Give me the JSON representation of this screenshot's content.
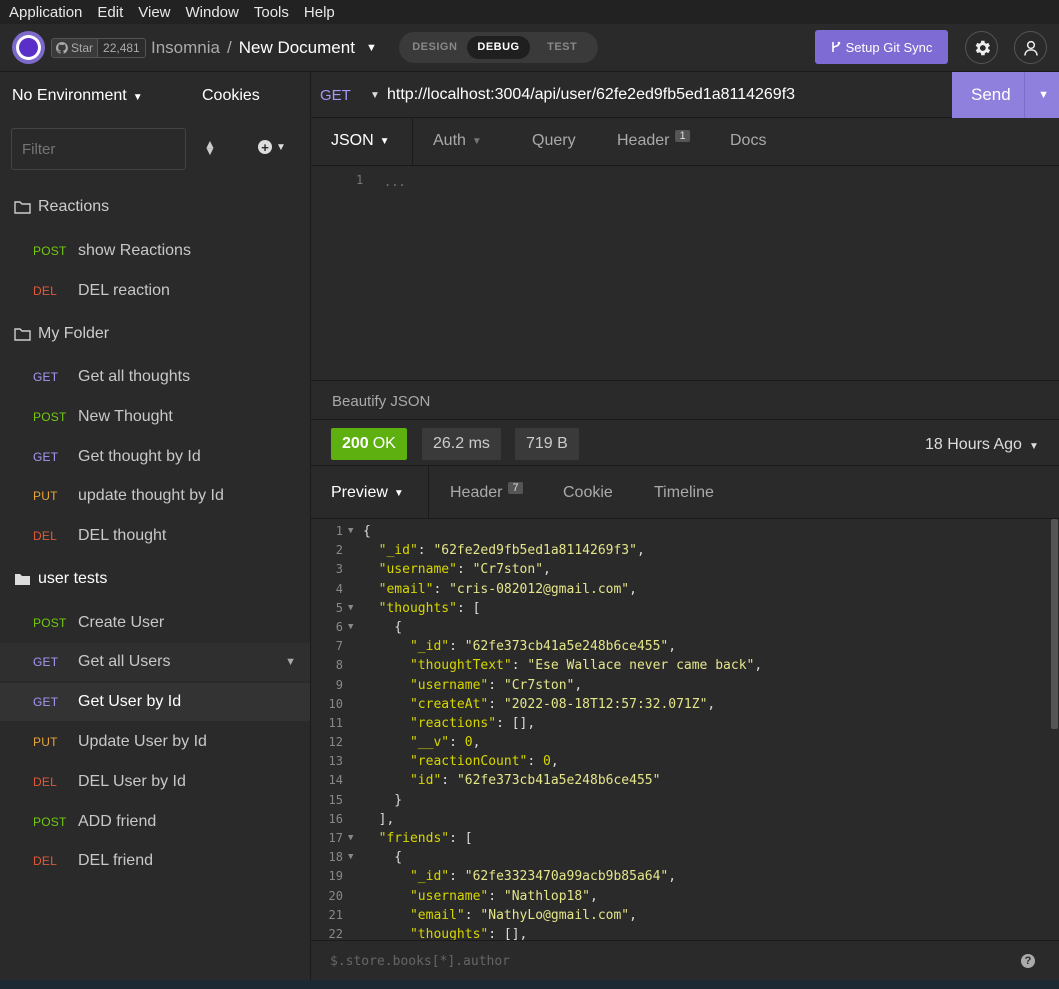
{
  "menubar": [
    "Application",
    "Edit",
    "View",
    "Window",
    "Tools",
    "Help"
  ],
  "header": {
    "github_star_label": "Star",
    "github_star_count": "22,481",
    "workspace": "Insomnia",
    "separator": "/",
    "document": "New Document",
    "modes": [
      "DESIGN",
      "DEBUG",
      "TEST"
    ],
    "active_mode": "DEBUG",
    "git_sync_label": "Setup Git Sync"
  },
  "sidebar": {
    "environment": "No Environment",
    "cookies": "Cookies",
    "filter_placeholder": "Filter",
    "folders": [
      {
        "name": "Reactions",
        "open": false,
        "items": [
          {
            "method": "POST",
            "label": "show Reactions"
          },
          {
            "method": "DEL",
            "label": "DEL reaction"
          }
        ]
      },
      {
        "name": "My Folder",
        "open": false,
        "items": [
          {
            "method": "GET",
            "label": "Get all thoughts"
          },
          {
            "method": "POST",
            "label": "New Thought"
          },
          {
            "method": "GET",
            "label": "Get thought by Id"
          },
          {
            "method": "PUT",
            "label": "update thought by Id"
          },
          {
            "method": "DEL",
            "label": "DEL thought"
          }
        ]
      },
      {
        "name": "user tests",
        "open": true,
        "items": [
          {
            "method": "POST",
            "label": "Create User"
          },
          {
            "method": "GET",
            "label": "Get all Users"
          },
          {
            "method": "GET",
            "label": "Get User by Id"
          },
          {
            "method": "PUT",
            "label": "Update User by Id"
          },
          {
            "method": "DEL",
            "label": "DEL User by Id"
          },
          {
            "method": "POST",
            "label": "ADD friend"
          },
          {
            "method": "DEL",
            "label": "DEL friend"
          }
        ]
      }
    ]
  },
  "request": {
    "method": "GET",
    "url": "http://localhost:3004/api/user/62fe2ed9fb5ed1a8114269f3",
    "send_label": "Send",
    "tabs": {
      "body": "JSON",
      "auth": "Auth",
      "query": "Query",
      "header": "Header",
      "header_count": "1",
      "docs": "Docs"
    },
    "body_line": "1",
    "body_placeholder": "...",
    "beautify": "Beautify JSON"
  },
  "response": {
    "status_code": "200",
    "status_text": "OK",
    "time": "26.2 ms",
    "size": "719 B",
    "ago": "18 Hours Ago",
    "tabs": {
      "preview": "Preview",
      "header": "Header",
      "header_count": "7",
      "cookie": "Cookie",
      "timeline": "Timeline"
    },
    "filter_placeholder": "$.store.books[*].author",
    "help": "?"
  },
  "colors": {
    "accent": "#7e6cd4",
    "post": "#72c90e",
    "get": "#a598f7",
    "put": "#e8a53b",
    "del": "#e05a3a",
    "ok": "#5db010"
  }
}
